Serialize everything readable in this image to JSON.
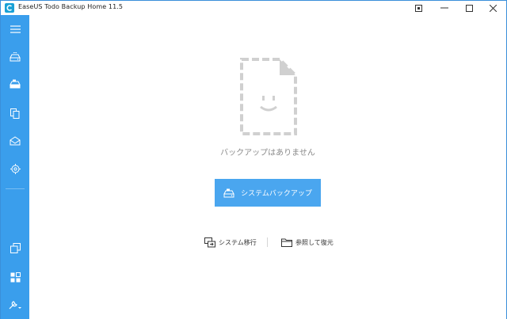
{
  "window": {
    "title": "EaseUS Todo Backup Home 11.5"
  },
  "sidebar": {
    "items": [
      {
        "icon": "menu-icon"
      },
      {
        "icon": "disk-backup-icon"
      },
      {
        "icon": "system-backup-icon"
      },
      {
        "icon": "file-backup-icon"
      },
      {
        "icon": "mail-backup-icon"
      },
      {
        "icon": "smart-backup-icon"
      },
      {
        "icon": "clone-icon"
      },
      {
        "icon": "apps-icon"
      },
      {
        "icon": "tools-icon"
      }
    ]
  },
  "main": {
    "empty_message": "バックアップはありません",
    "primary_action": "システムバックアップ",
    "secondary_actions": [
      {
        "label": "システム移行",
        "icon": "system-transfer-icon"
      },
      {
        "label": "参照して復元",
        "icon": "folder-icon"
      }
    ]
  },
  "colors": {
    "sidebar": "#3a9eec",
    "primary_button": "#4aa6ef",
    "illustration": "#d0d0d0"
  }
}
